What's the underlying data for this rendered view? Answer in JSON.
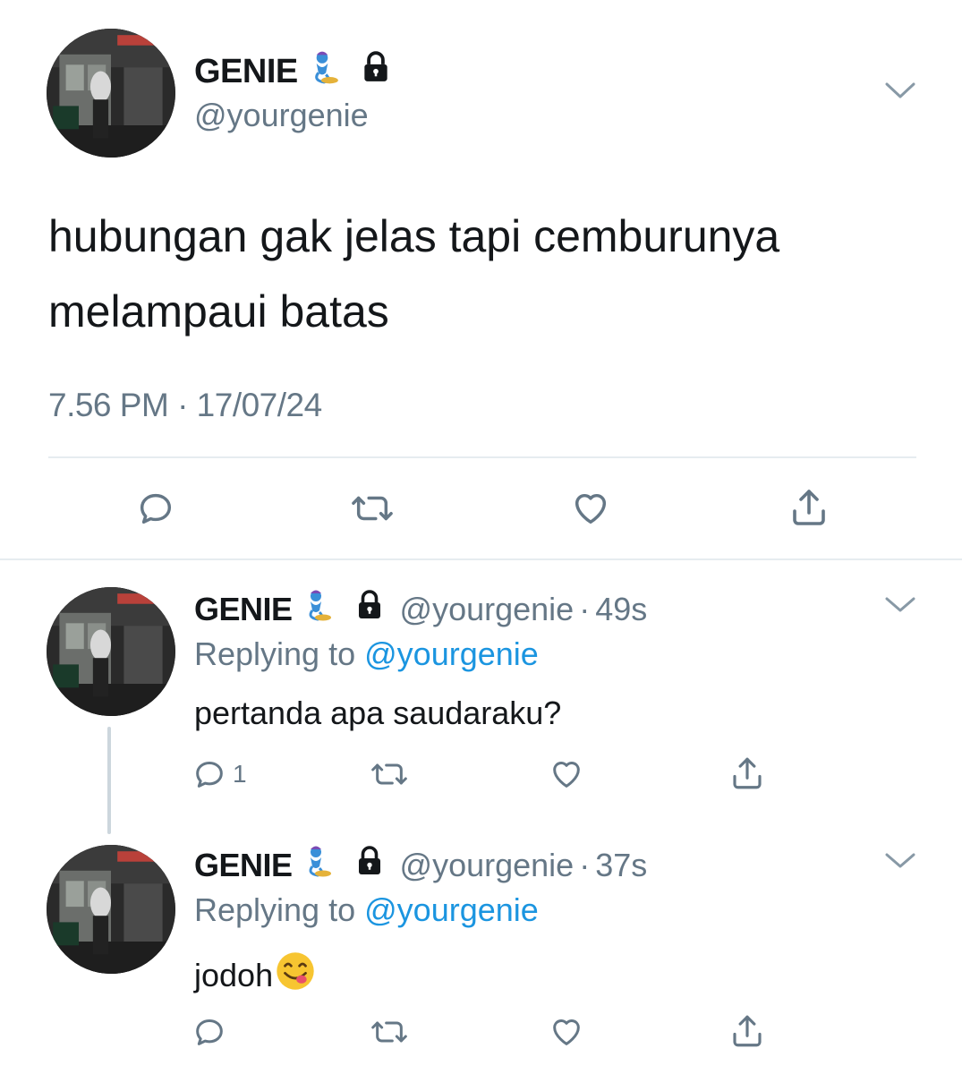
{
  "main_tweet": {
    "display_name": "GENIE",
    "handle": "@yourgenie",
    "text": "hubungan gak jelas tapi cemburunya melampaui batas",
    "timestamp": "7.56 PM · 17/07/24",
    "actions": [
      "reply-icon",
      "retweet-icon",
      "like-icon",
      "share-icon"
    ]
  },
  "replies": [
    {
      "display_name": "GENIE",
      "handle": "@yourgenie",
      "separator": "·",
      "age": "49s",
      "replying_prefix": "Replying to",
      "replying_to": "@yourgenie",
      "text": "pertanda apa saudaraku?",
      "reply_count": "1"
    },
    {
      "display_name": "GENIE",
      "handle": "@yourgenie",
      "separator": "·",
      "age": "37s",
      "replying_prefix": "Replying to",
      "replying_to": "@yourgenie",
      "text": "jodoh",
      "emoji": "😋",
      "reply_count": ""
    }
  ],
  "colors": {
    "text": "#14171a",
    "muted": "#657786",
    "link": "#1b95e0",
    "divider": "#e6ecf0",
    "icon": "#657786"
  }
}
